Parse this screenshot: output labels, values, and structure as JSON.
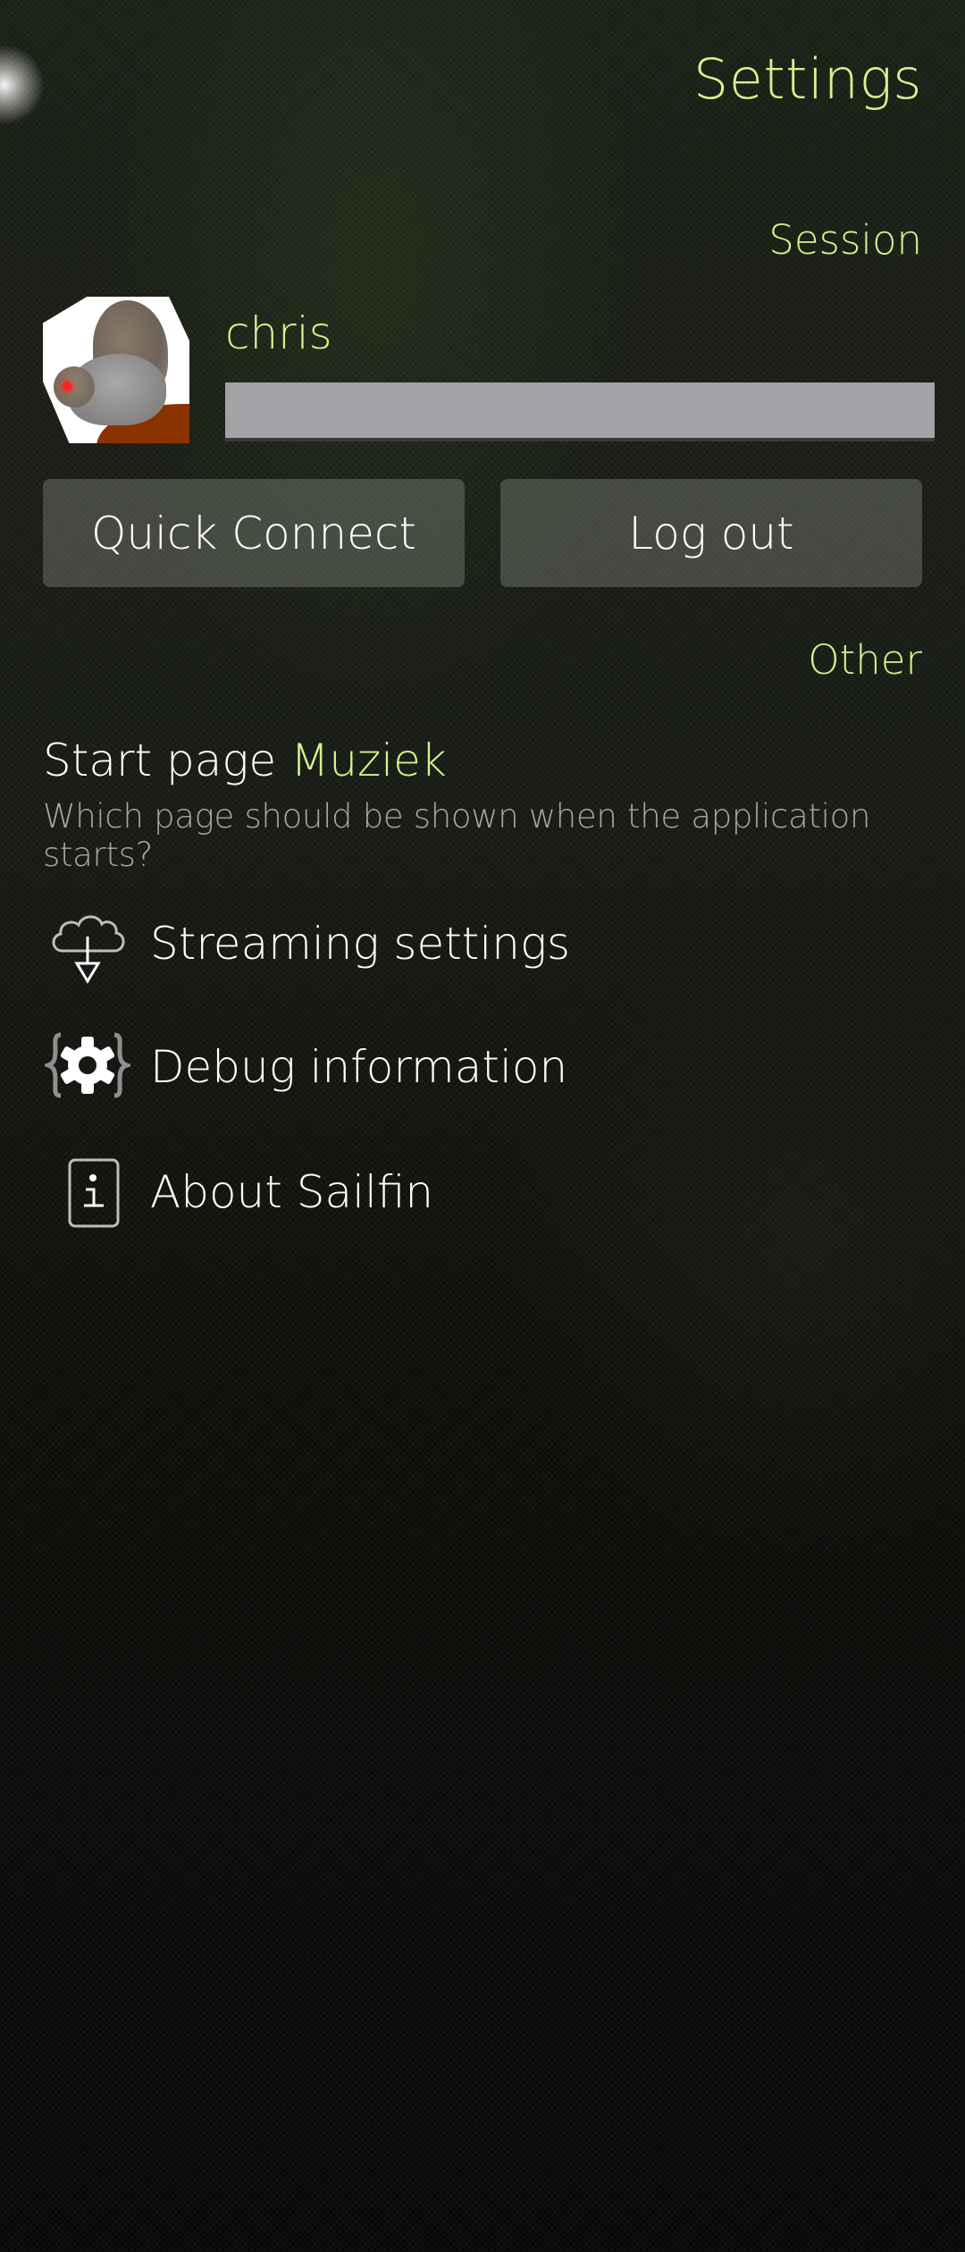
{
  "page": {
    "title": "Settings",
    "accent_color": "#d5f28f"
  },
  "session": {
    "header": "Session",
    "username": "chris",
    "password_field_value": "",
    "avatar_icon": "squirrel-avatar",
    "buttons": {
      "quick_connect": "Quick Connect",
      "log_out": "Log out"
    }
  },
  "other": {
    "header": "Other",
    "start_page": {
      "label": "Start page",
      "value": "Muziek",
      "description": "Which page should be shown when the application starts?"
    },
    "menu": [
      {
        "label": "Streaming settings",
        "icon": "cloud-download-icon"
      },
      {
        "label": "Debug information",
        "icon": "debug-gear-icon"
      },
      {
        "label": "About Sailfin",
        "icon": "info-icon"
      }
    ]
  }
}
